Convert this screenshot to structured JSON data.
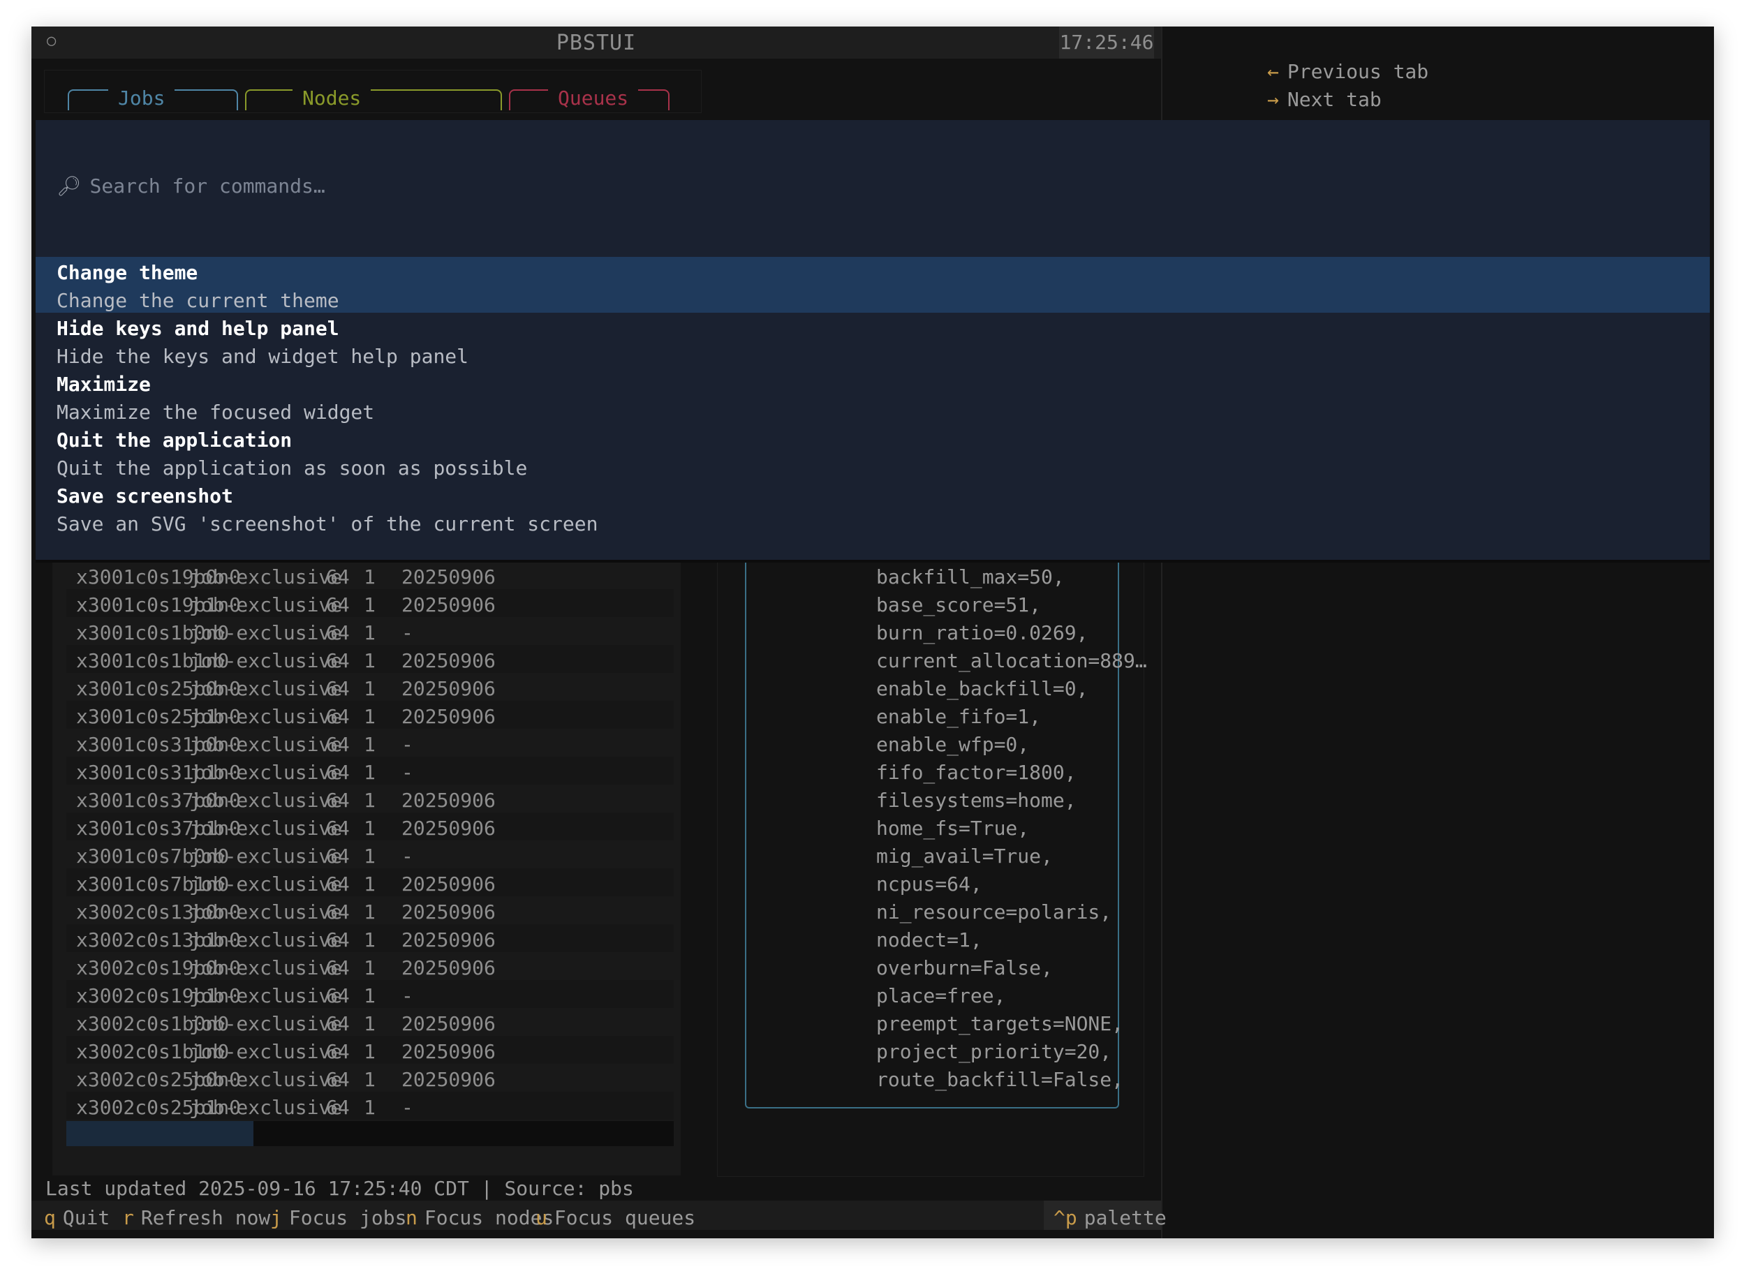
{
  "app": {
    "title": "PBSTUI",
    "clock": "17:25:46",
    "dot": "○"
  },
  "tabs": [
    {
      "label": "Jobs",
      "color": "#4f86a6"
    },
    {
      "label": "Nodes",
      "color": "#8a9a2a"
    },
    {
      "label": "Queues",
      "color": "#a8324a"
    }
  ],
  "help": [
    {
      "arrow": "←",
      "label": "Previous tab"
    },
    {
      "arrow": "→",
      "label": "Next tab"
    }
  ],
  "palette": {
    "placeholder": "Search for commands…",
    "commands": [
      {
        "title": "Change theme",
        "desc": "Change the current theme",
        "selected": true
      },
      {
        "title": "Hide keys and help panel",
        "desc": "Hide the keys and widget help panel"
      },
      {
        "title": "Maximize",
        "desc": "Maximize the focused widget"
      },
      {
        "title": "Quit the application",
        "desc": "Quit the application as soon as possible"
      },
      {
        "title": "Save screenshot",
        "desc": "Save an SVG 'screenshot' of the current screen"
      }
    ]
  },
  "nodes": [
    [
      "x3001c0s19b0n0",
      "job-exclusive",
      "64",
      "1",
      "20250906"
    ],
    [
      "x3001c0s19b1n0",
      "job-exclusive",
      "64",
      "1",
      "20250906"
    ],
    [
      "x3001c0s1b0n0",
      "job-exclusive",
      "64",
      "1",
      "-"
    ],
    [
      "x3001c0s1b1n0",
      "job-exclusive",
      "64",
      "1",
      "20250906"
    ],
    [
      "x3001c0s25b0n0",
      "job-exclusive",
      "64",
      "1",
      "20250906"
    ],
    [
      "x3001c0s25b1n0",
      "job-exclusive",
      "64",
      "1",
      "20250906"
    ],
    [
      "x3001c0s31b0n0",
      "job-exclusive",
      "64",
      "1",
      "-"
    ],
    [
      "x3001c0s31b1n0",
      "job-exclusive",
      "64",
      "1",
      "-"
    ],
    [
      "x3001c0s37b0n0",
      "job-exclusive",
      "64",
      "1",
      "20250906"
    ],
    [
      "x3001c0s37b1n0",
      "job-exclusive",
      "64",
      "1",
      "20250906"
    ],
    [
      "x3001c0s7b0n0",
      "job-exclusive",
      "64",
      "1",
      "-"
    ],
    [
      "x3001c0s7b1n0",
      "job-exclusive",
      "64",
      "1",
      "20250906"
    ],
    [
      "x3002c0s13b0n0",
      "job-exclusive",
      "64",
      "1",
      "20250906"
    ],
    [
      "x3002c0s13b1n0",
      "job-exclusive",
      "64",
      "1",
      "20250906"
    ],
    [
      "x3002c0s19b0n0",
      "job-exclusive",
      "64",
      "1",
      "20250906"
    ],
    [
      "x3002c0s19b1n0",
      "job-exclusive",
      "64",
      "1",
      "-"
    ],
    [
      "x3002c0s1b0n0",
      "job-exclusive",
      "64",
      "1",
      "20250906"
    ],
    [
      "x3002c0s1b1n0",
      "job-exclusive",
      "64",
      "1",
      "20250906"
    ],
    [
      "x3002c0s25b0n0",
      "job-exclusive",
      "64",
      "1",
      "20250906"
    ],
    [
      "x3002c0s25b1n0",
      "job-exclusive",
      "64",
      "1",
      "-"
    ]
  ],
  "info_lines": [
    "backfill_max=50,",
    "base_score=51,",
    "burn_ratio=0.0269,",
    "current_allocation=889…",
    "enable_backfill=0,",
    "enable_fifo=1,",
    "enable_wfp=0,",
    "fifo_factor=1800,",
    "filesystems=home,",
    "home_fs=True,",
    "mig_avail=True,",
    "ncpus=64,",
    "ni_resource=polaris,",
    "nodect=1,",
    "overburn=False,",
    "place=free,",
    "preempt_targets=NONE,",
    "project_priority=20,",
    "route_backfill=False,"
  ],
  "status": "Last updated 2025-09-16 17:25:40 CDT | Source: pbs",
  "footer": [
    {
      "key": "q",
      "label": "Quit"
    },
    {
      "key": "r",
      "label": "Refresh now"
    },
    {
      "key": "j",
      "label": "Focus jobs"
    },
    {
      "key": "n",
      "label": "Focus nodes"
    },
    {
      "key": "u",
      "label": "Focus queues"
    }
  ],
  "palette_key": {
    "key": "^p",
    "label": "palette"
  }
}
